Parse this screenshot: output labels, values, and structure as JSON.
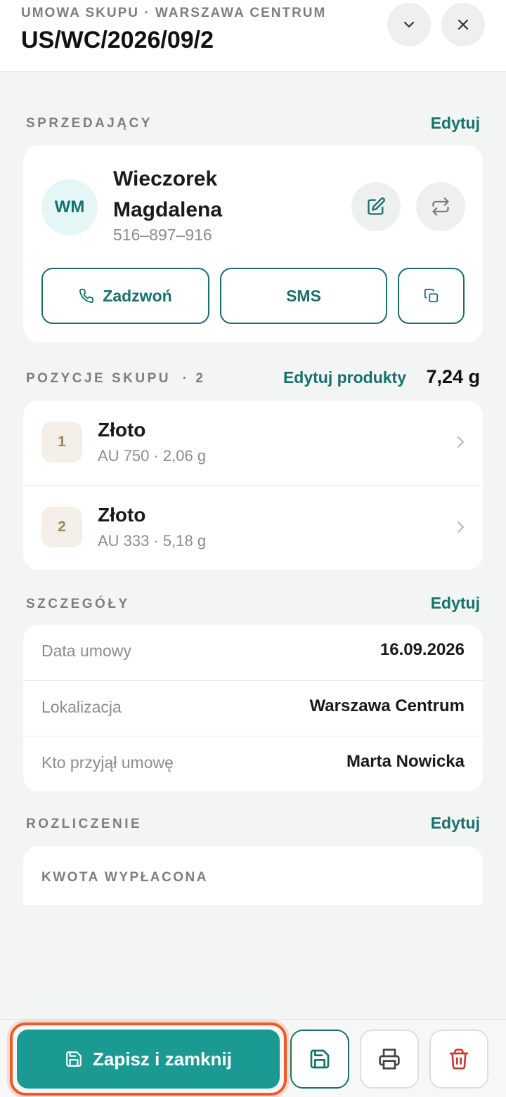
{
  "header": {
    "kicker": "UMOWA SKUPU · WARSZAWA CENTRUM",
    "title": "US/WC/2026/09/2"
  },
  "seller": {
    "section_label": "SPRZEDAJĄCY",
    "edit_label": "Edytuj",
    "initials": "WM",
    "name": "Wieczorek Magdalena",
    "phone": "516–897–916",
    "call_label": "Zadzwoń",
    "sms_label": "SMS"
  },
  "items": {
    "section_label": "POZYCJE SKUPU",
    "count": "· 2",
    "edit_label": "Edytuj produkty",
    "total_weight": "7,24 g",
    "rows": [
      {
        "index": "1",
        "name": "Złoto",
        "sub": "AU 750 · 2,06 g"
      },
      {
        "index": "2",
        "name": "Złoto",
        "sub": "AU 333 · 5,18 g"
      }
    ]
  },
  "details": {
    "section_label": "SZCZEGÓŁY",
    "edit_label": "Edytuj",
    "rows": [
      {
        "label": "Data umowy",
        "value": "16.09.2026"
      },
      {
        "label": "Lokalizacja",
        "value": "Warszawa Centrum"
      },
      {
        "label": "Kto przyjął umowę",
        "value": "Marta Nowicka"
      }
    ]
  },
  "settlement": {
    "section_label": "ROZLICZENIE",
    "edit_label": "Edytuj",
    "amount_label": "KWOTA WYPŁACONA"
  },
  "bottom": {
    "primary_label": "Zapisz i zamknij"
  },
  "colors": {
    "accent": "#17706c",
    "primary": "#1a9a93",
    "highlight": "#ef5a24",
    "danger": "#c63b2f"
  }
}
